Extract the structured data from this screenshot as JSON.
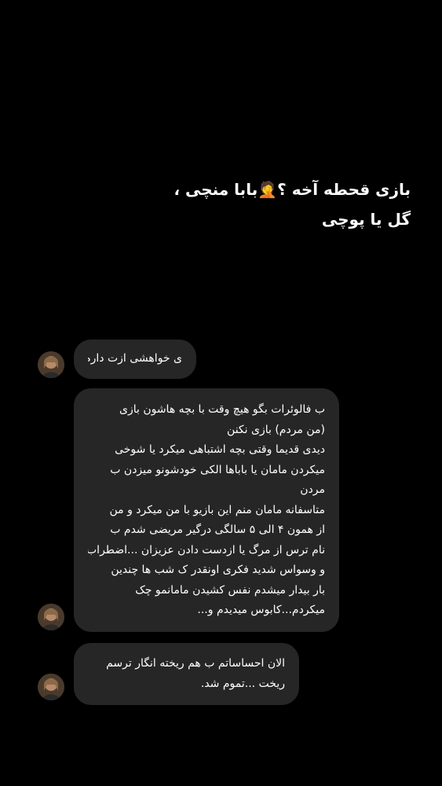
{
  "story": {
    "caption_line_1": "بازی قحطه آخه ؟",
    "caption_emoji": "🤦",
    "caption_line_1_rest": "بابا منچی ،",
    "caption_line_2": "گل یا پوچی"
  },
  "messages": [
    {
      "lines": [
        "ی خواهشی ازت دارم"
      ]
    },
    {
      "lines": [
        "ب فالوئرات بگو هیچ وقت با بچه هاشون بازی",
        "(من مردم) بازی نکنن",
        "دیدی قدیما وقتی بچه اشتباهی میکرد یا شوخی",
        "میکردن مامان یا باباها الکی خودشونو میزدن ب",
        "مردن",
        "متاسفانه مامان منم این بازیو با من میکرد و من",
        "از همون ۴ الی ۵ سالگی درگیر مریضی  شدم ب",
        "نام ترس از مرگ یا ازدست دادن عزیزان ...اضطراب",
        "و وسواس شدید فکری اونقدر ک شب ها چندین",
        "بار بیدار میشدم نفس کشیدن مامانمو چک",
        "میکردم...کابوس میدیدم و..."
      ]
    },
    {
      "lines": [
        "الان احساساتم ب هم ریخته انگار ترسم",
        "ریخت ...تموم شد."
      ]
    }
  ],
  "colors": {
    "background": "#000000",
    "bubble": "#262626",
    "text": "#ffffff"
  }
}
